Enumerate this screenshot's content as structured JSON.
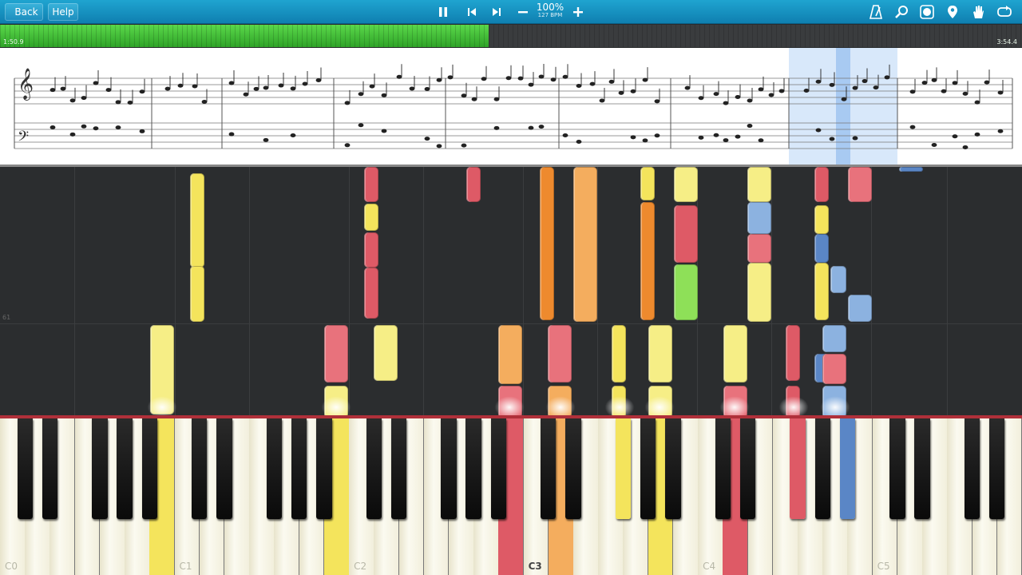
{
  "toolbar": {
    "back_label": "Back",
    "help_label": "Help",
    "speed": "100%",
    "bpm": "127 BPM",
    "icons": [
      "pause-icon",
      "skip-back-icon",
      "skip-forward-icon",
      "minus-icon",
      "plus-icon",
      "metronome-icon",
      "zoom-icon",
      "labels-icon",
      "marker-icon",
      "hand-icon",
      "loop-icon"
    ]
  },
  "progress": {
    "current_time": "1:50.9",
    "total_time": "3:54.4",
    "fraction": 0.478
  },
  "roll": {
    "lane_label": "61"
  },
  "keyboard": {
    "octave_labels": [
      "C0",
      "C1",
      "C2",
      "C3",
      "C4",
      "C5"
    ],
    "active_label": "C3"
  },
  "colors": {
    "yellow": "#f4e45c",
    "pale_yellow": "#f6ee86",
    "red": "#de5a66",
    "pink": "#e8727c",
    "orange": "#ee8a2e",
    "light_orange": "#f4ad5e",
    "blue": "#5a86c6",
    "light_blue": "#8cb2e0",
    "green": "#8ee058",
    "progress_green": "#3cc034",
    "toolbar_blue": "#1b95c6"
  }
}
